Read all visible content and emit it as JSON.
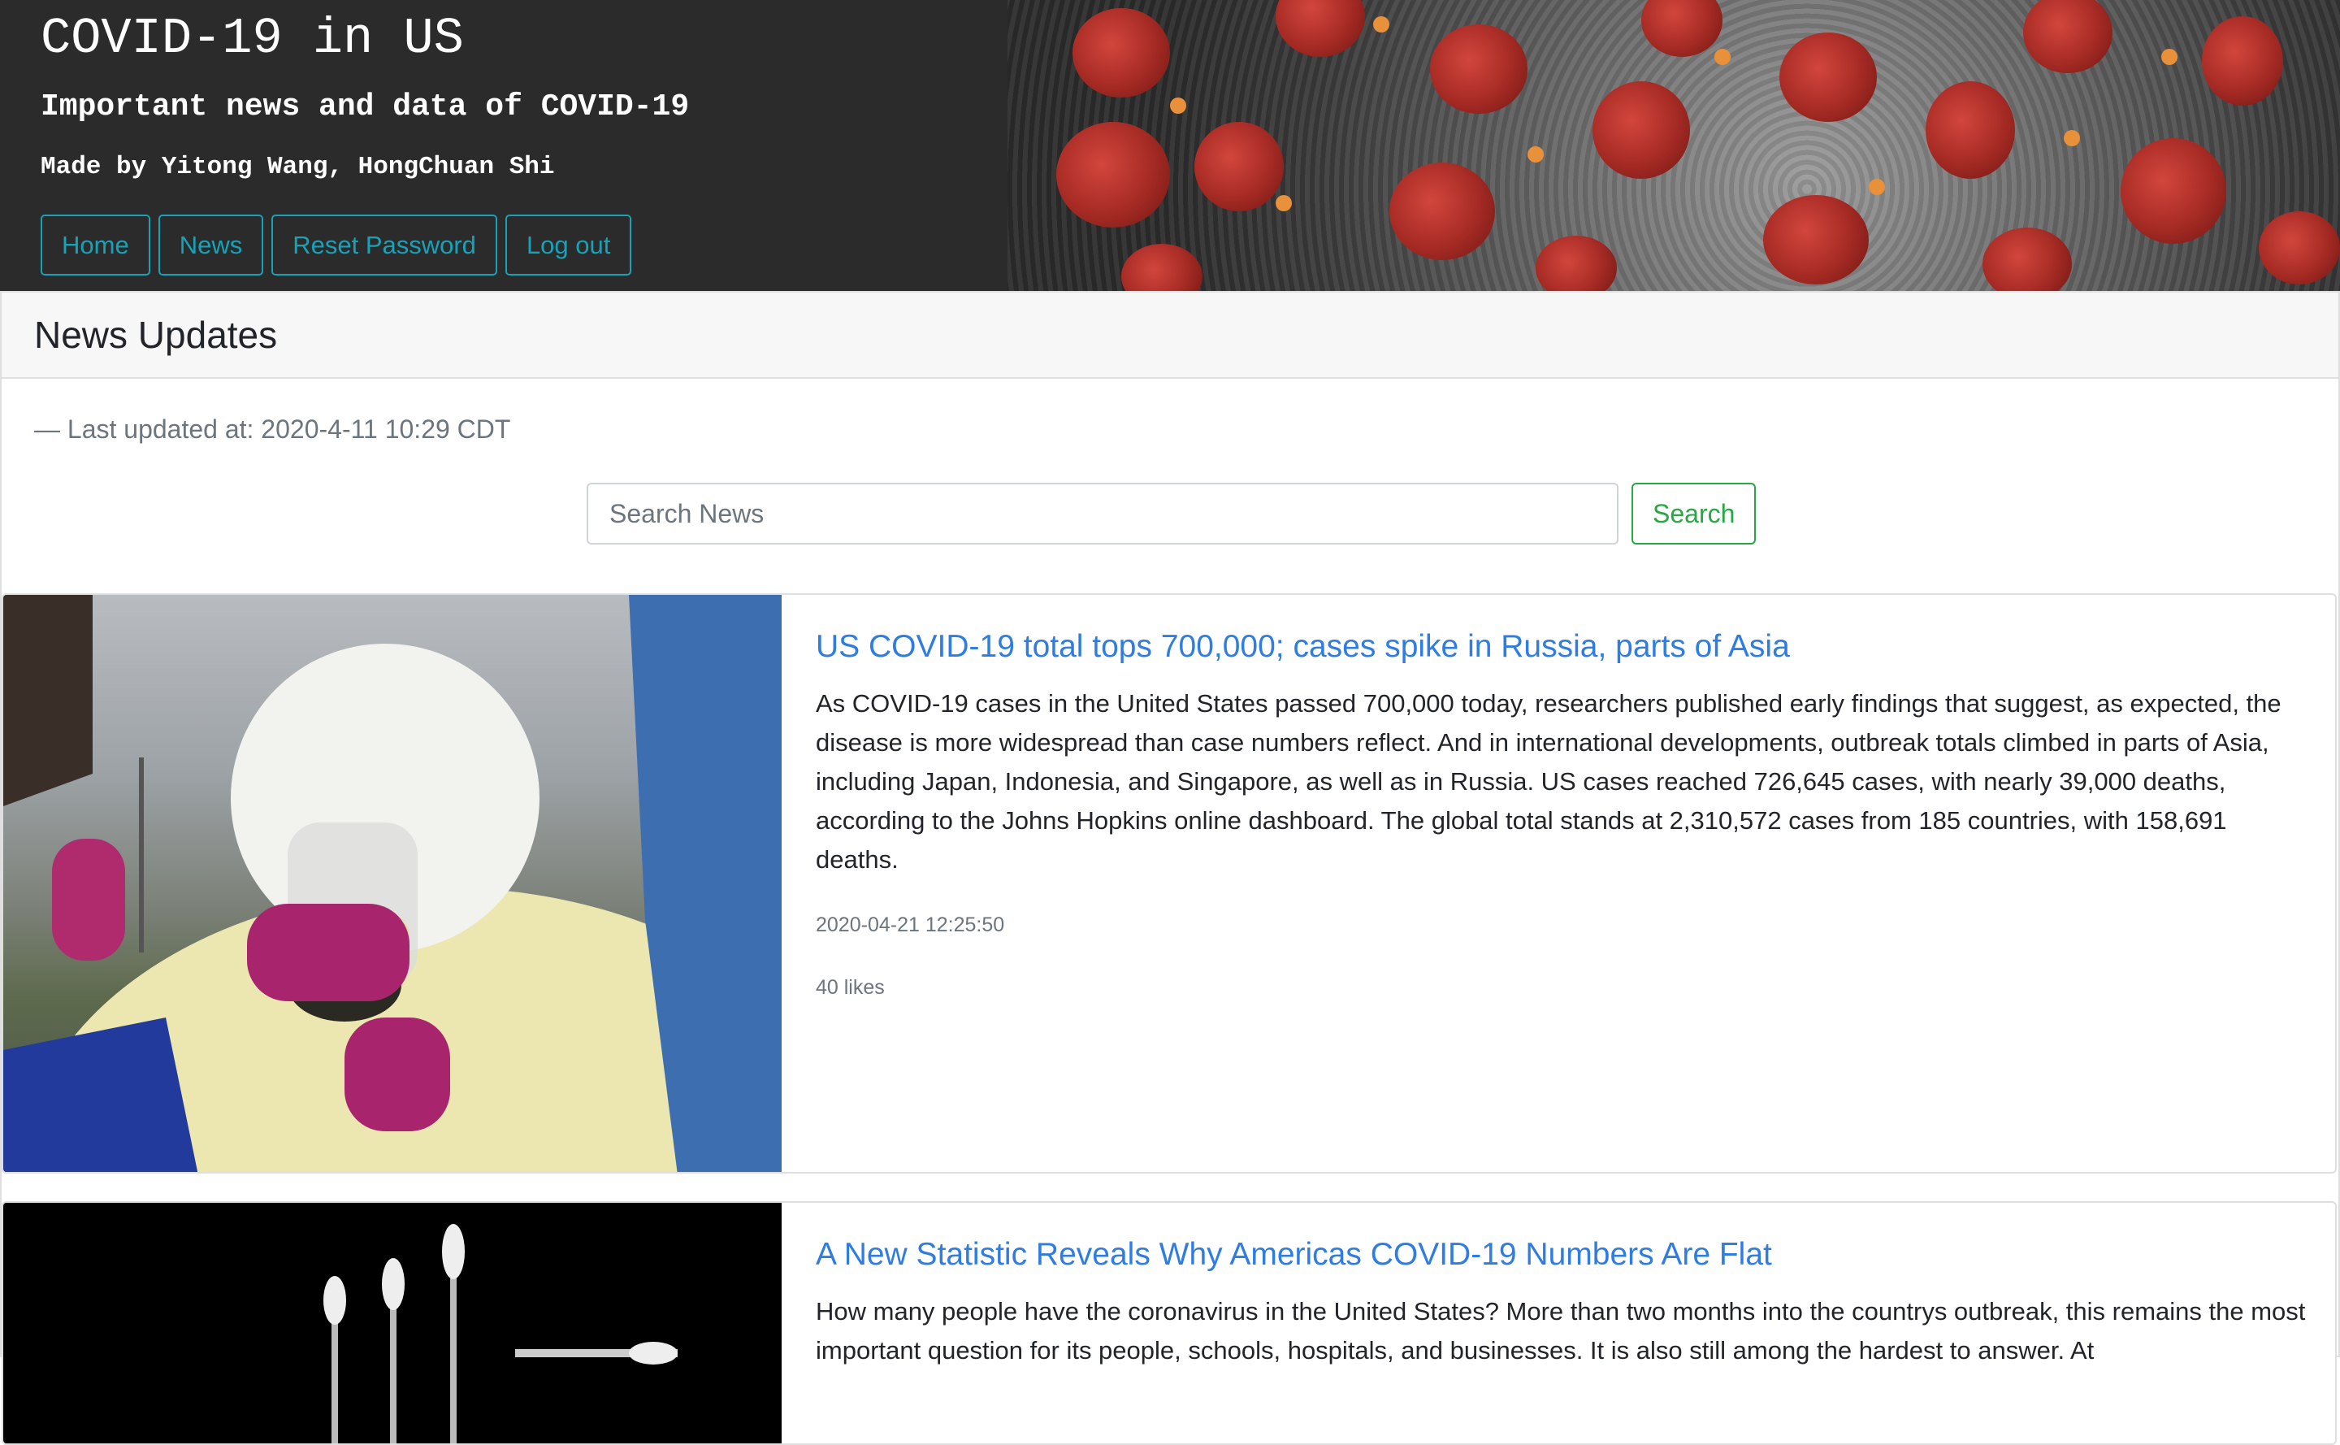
{
  "header": {
    "title": "COVID-19 in US",
    "subtitle": "Important news and data of COVID-19",
    "authors": "Made by Yitong Wang, HongChuan Shi"
  },
  "nav": {
    "home": "Home",
    "news": "News",
    "reset_password": "Reset Password",
    "logout": "Log out"
  },
  "news_section": {
    "heading": "News Updates",
    "last_updated": "— Last updated at: 2020-4-11 10:29 CDT",
    "search_placeholder": "Search News",
    "search_button": "Search"
  },
  "articles": [
    {
      "title": "US COVID-19 total tops 700,000; cases spike in Russia, parts of Asia",
      "summary": "As COVID-19 cases in the United States passed 700,000 today, researchers published early findings that suggest, as expected, the disease is more widespread than case numbers reflect. And in international developments, outbreak totals climbed in parts of Asia, including Japan, Indonesia, and Singapore, as well as in Russia. US cases reached 726,645 cases, with nearly 39,000 deaths, according to the Johns Hopkins online dashboard. The global total stands at 2,310,572 cases from 185 countries, with 158,691 deaths.",
      "date": "2020-04-21 12:25:50",
      "likes": "40 likes"
    },
    {
      "title": "A New Statistic Reveals Why Americas COVID-19 Numbers Are Flat",
      "summary": "How many people have the coronavirus in the United States? More than two months into the countrys outbreak, this remains the most important question for its people, schools, hospitals, and businesses. It is also still among the hardest to answer. At"
    }
  ],
  "colors": {
    "nav_outline": "#17a2b8",
    "search_button": "#28a745",
    "link": "#2f7de1"
  }
}
